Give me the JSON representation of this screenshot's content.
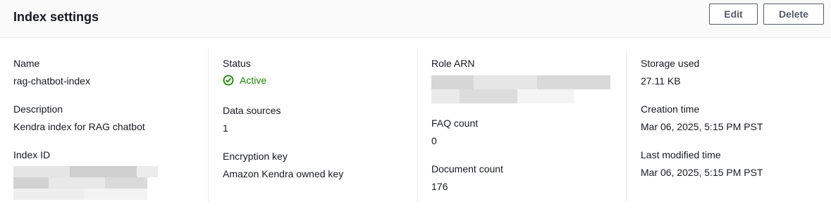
{
  "header": {
    "title": "Index settings",
    "edit_label": "Edit",
    "delete_label": "Delete"
  },
  "columns": {
    "col1": {
      "name_label": "Name",
      "name_value": "rag-chatbot-index",
      "description_label": "Description",
      "description_value": "Kendra index for RAG chatbot",
      "index_id_label": "Index ID"
    },
    "col2": {
      "status_label": "Status",
      "status_value": "Active",
      "data_sources_label": "Data sources",
      "data_sources_value": "1",
      "encryption_label": "Encryption key",
      "encryption_value": "Amazon Kendra owned key"
    },
    "col3": {
      "role_arn_label": "Role ARN",
      "faq_count_label": "FAQ count",
      "faq_count_value": "0",
      "document_count_label": "Document count",
      "document_count_value": "176"
    },
    "col4": {
      "storage_label": "Storage used",
      "storage_value": "27.11 KB",
      "creation_label": "Creation time",
      "creation_value": "Mar 06, 2025, 5:15 PM PST",
      "modified_label": "Last modified time",
      "modified_value": "Mar 06, 2025, 5:15 PM PST"
    }
  },
  "colors": {
    "status_active": "#1d8102",
    "button_border": "#545b64",
    "header_bg": "#fafafa"
  },
  "icons": {
    "status": "check-circle-icon"
  }
}
